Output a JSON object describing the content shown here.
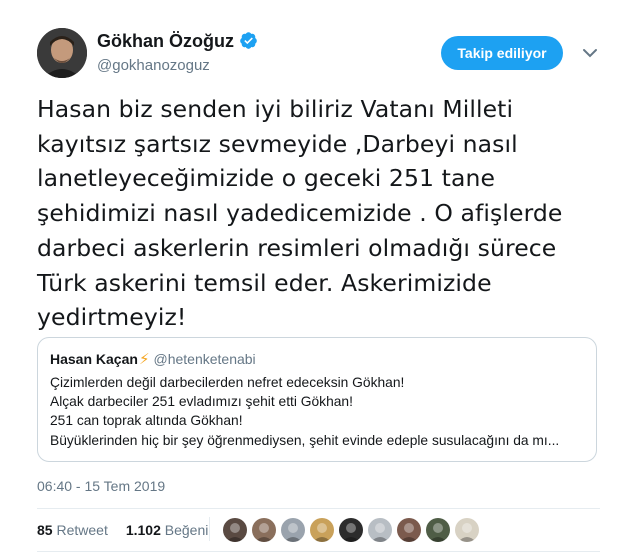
{
  "author": {
    "name": "Gökhan Özoğuz",
    "handle": "@gokhanozoguz",
    "verified": true,
    "follow_label": "Takip ediliyor"
  },
  "tweet": {
    "lines": [
      "Hasan biz senden iyi biliriz Vatanı Milleti",
      "kayıtsız şartsız sevmeyide ,Darbeyi nasıl",
      "lanetleyeceğimizide o geceki 251 tane",
      "şehidimizi nasıl yadedicemizide . O afişlerde",
      "darbeci askerlerin resimleri olmadığı sürece",
      "Türk askerini temsil eder. Askerimizide",
      "yedirtmeyiz!"
    ]
  },
  "quote": {
    "name": "Hasan Kaçan",
    "bolt": "⚡",
    "handle": "@hetenketenabi",
    "lines": [
      "Çizimlerden değil darbecilerden nefret edeceksin Gökhan!",
      "Alçak darbeciler 251 evladımızı şehit etti Gökhan!",
      "251 can toprak altında Gökhan!",
      "Büyüklerinden hiç bir şey öğrenmediysen, şehit evinde edeple susulacağını da mı..."
    ]
  },
  "timestamp": "06:40 - 15 Tem 2019",
  "stats": {
    "retweet_count": "85",
    "retweet_label": "Retweet",
    "like_count": "1.102",
    "like_label": "Beğeni"
  },
  "likers": [
    {
      "icon": "liker-avatar",
      "color": "#5a4a42"
    },
    {
      "icon": "liker-avatar",
      "color": "#8a6f5c"
    },
    {
      "icon": "liker-avatar",
      "color": "#9aa3ad"
    },
    {
      "icon": "liker-avatar",
      "color": "#c9a15a"
    },
    {
      "icon": "liker-avatar",
      "color": "#2c2c2c"
    },
    {
      "icon": "liker-avatar",
      "color": "#b8bec4"
    },
    {
      "icon": "liker-avatar",
      "color": "#7b5a4d"
    },
    {
      "icon": "liker-avatar",
      "color": "#4f5d46"
    },
    {
      "icon": "liker-avatar",
      "color": "#d8d2c4"
    }
  ],
  "colors": {
    "accent": "#1da1f2",
    "secondary_text": "#657786",
    "border": "#ccd6dd"
  }
}
